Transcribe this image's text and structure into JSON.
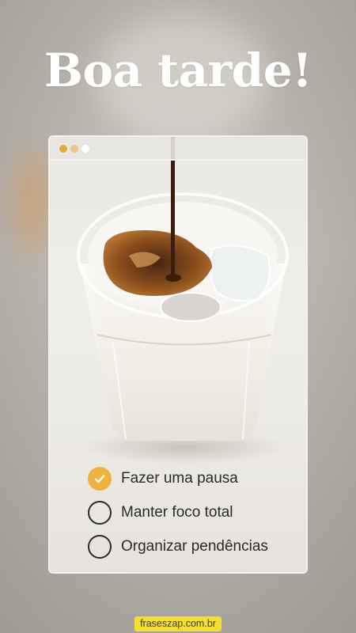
{
  "greeting": "Boa tarde!",
  "window": {
    "dots": [
      "#e5a83a",
      "#ecc58a",
      "#ffffff"
    ]
  },
  "checklist": [
    {
      "label": "Fazer uma pausa",
      "checked": true,
      "icon": "check-icon"
    },
    {
      "label": "Manter foco total",
      "checked": false,
      "icon": "circle-icon"
    },
    {
      "label": "Organizar pendências",
      "checked": false,
      "icon": "circle-icon"
    }
  ],
  "footer": {
    "site": "fraseszap.com.br"
  },
  "colors": {
    "accent": "#efb23e",
    "badge": "#f6de2c",
    "text_light": "#ffffff",
    "text_dark": "#2a2a2a"
  }
}
